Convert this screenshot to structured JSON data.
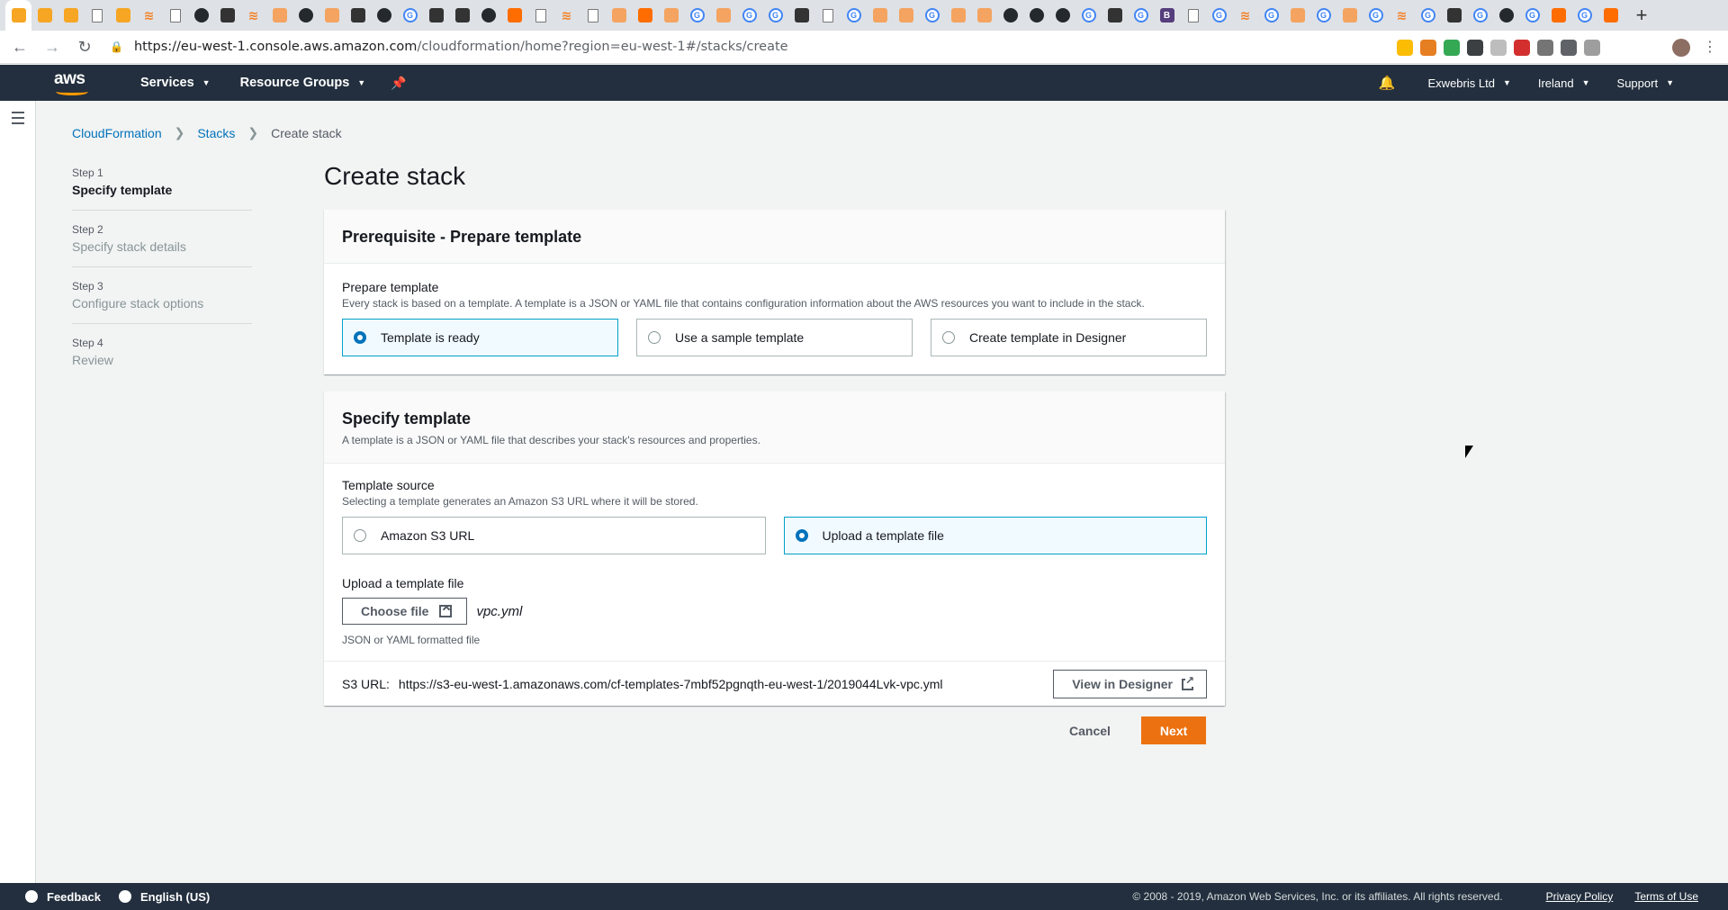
{
  "browser": {
    "url_host": "https://eu-west-1.console.aws.amazon.com",
    "url_path": "/cloudformation/home?region=eu-west-1#/stacks/create",
    "tabs": [
      {
        "icon": "aws-cube-icon",
        "kind": "aws",
        "active": true
      },
      {
        "icon": "aws-cube-icon",
        "kind": "aws"
      },
      {
        "icon": "aws-cube-icon",
        "kind": "aws"
      },
      {
        "icon": "doc-icon",
        "kind": "doc"
      },
      {
        "icon": "aws-cube-icon",
        "kind": "aws"
      },
      {
        "icon": "stackoverflow-icon",
        "kind": "so"
      },
      {
        "icon": "doc-icon",
        "kind": "doc"
      },
      {
        "icon": "github-icon",
        "kind": "gh"
      },
      {
        "icon": "pointer-icon",
        "kind": "dark"
      },
      {
        "icon": "stackoverflow-icon",
        "kind": "so"
      },
      {
        "icon": "box-icon",
        "kind": "box"
      },
      {
        "icon": "github-icon",
        "kind": "gh"
      },
      {
        "icon": "box-icon",
        "kind": "box"
      },
      {
        "icon": "table-icon",
        "kind": "dark"
      },
      {
        "icon": "github-icon",
        "kind": "gh"
      },
      {
        "icon": "google-icon",
        "kind": "g"
      },
      {
        "icon": "diamond-icon",
        "kind": "dark"
      },
      {
        "icon": "jg-icon",
        "kind": "dark"
      },
      {
        "icon": "github-icon",
        "kind": "gh"
      },
      {
        "icon": "orange-cube-icon",
        "kind": "org"
      },
      {
        "icon": "doc-icon",
        "kind": "doc"
      },
      {
        "icon": "stackoverflow-icon",
        "kind": "so"
      },
      {
        "icon": "doc-icon",
        "kind": "doc"
      },
      {
        "icon": "box-icon",
        "kind": "box"
      },
      {
        "icon": "orange-cube-icon",
        "kind": "org"
      },
      {
        "icon": "box-icon",
        "kind": "box"
      },
      {
        "icon": "google-icon",
        "kind": "g"
      },
      {
        "icon": "box-icon",
        "kind": "box"
      },
      {
        "icon": "google-icon",
        "kind": "g"
      },
      {
        "icon": "google-icon",
        "kind": "g"
      },
      {
        "icon": "php-icon",
        "kind": "dark"
      },
      {
        "icon": "doc-icon",
        "kind": "doc"
      },
      {
        "icon": "google-icon",
        "kind": "g"
      },
      {
        "icon": "box-icon",
        "kind": "box"
      },
      {
        "icon": "box-icon",
        "kind": "box"
      },
      {
        "icon": "google-icon",
        "kind": "g"
      },
      {
        "icon": "box-icon",
        "kind": "box"
      },
      {
        "icon": "box-icon",
        "kind": "box"
      },
      {
        "icon": "github-icon",
        "kind": "gh"
      },
      {
        "icon": "github-icon",
        "kind": "gh"
      },
      {
        "icon": "github-icon",
        "kind": "gh"
      },
      {
        "icon": "google-icon",
        "kind": "g"
      },
      {
        "icon": "php-icon",
        "kind": "dark"
      },
      {
        "icon": "google-icon",
        "kind": "g"
      },
      {
        "icon": "bootstrap-icon",
        "kind": "b"
      },
      {
        "icon": "doc-icon",
        "kind": "doc"
      },
      {
        "icon": "google-icon",
        "kind": "g"
      },
      {
        "icon": "stackoverflow-icon",
        "kind": "so"
      },
      {
        "icon": "google-icon",
        "kind": "g"
      },
      {
        "icon": "box-icon",
        "kind": "box"
      },
      {
        "icon": "google-icon",
        "kind": "g"
      },
      {
        "icon": "box-icon",
        "kind": "box"
      },
      {
        "icon": "google-icon",
        "kind": "g"
      },
      {
        "icon": "stackoverflow-icon",
        "kind": "so"
      },
      {
        "icon": "google-icon",
        "kind": "g"
      },
      {
        "icon": "dark-icon",
        "kind": "dark"
      },
      {
        "icon": "google-icon",
        "kind": "g"
      },
      {
        "icon": "github-icon",
        "kind": "gh"
      },
      {
        "icon": "google-icon",
        "kind": "g"
      },
      {
        "icon": "orange-cube-icon",
        "kind": "org"
      },
      {
        "icon": "google-icon",
        "kind": "g"
      },
      {
        "icon": "orange-cube-icon",
        "kind": "org"
      }
    ],
    "new_tab_glyph": "+",
    "extensions": [
      {
        "icon": "ext-badge-icon",
        "color": "#fbbc04"
      },
      {
        "icon": "ext-fire-icon",
        "color": "#e67e22"
      },
      {
        "icon": "ext-green-icon",
        "color": "#34a853"
      },
      {
        "icon": "ext-moon-icon",
        "color": "#3c4043"
      },
      {
        "icon": "ext-arrow-icon",
        "color": "#bdbdbd"
      },
      {
        "icon": "ext-abp-icon",
        "color": "#d32f2f"
      },
      {
        "icon": "ext-camera-icon",
        "color": "#757575"
      },
      {
        "icon": "ext-rss-icon",
        "color": "#5f6368"
      },
      {
        "icon": "ext-shield-icon",
        "color": "#9e9e9e"
      }
    ]
  },
  "aws_header": {
    "logo_text": "aws",
    "services": "Services",
    "resource_groups": "Resource Groups",
    "account": "Exwebris Ltd",
    "region": "Ireland",
    "support": "Support"
  },
  "breadcrumb": [
    "CloudFormation",
    "Stacks",
    "Create stack"
  ],
  "steps": [
    {
      "num": "Step 1",
      "label": "Specify template",
      "active": true
    },
    {
      "num": "Step 2",
      "label": "Specify stack details"
    },
    {
      "num": "Step 3",
      "label": "Configure stack options"
    },
    {
      "num": "Step 4",
      "label": "Review"
    }
  ],
  "page_title": "Create stack",
  "prereq": {
    "title": "Prerequisite - Prepare template",
    "field_label": "Prepare template",
    "field_desc": "Every stack is based on a template. A template is a JSON or YAML file that contains configuration information about the AWS resources you want to include in the stack.",
    "options": [
      "Template is ready",
      "Use a sample template",
      "Create template in Designer"
    ],
    "selected": 0
  },
  "specify": {
    "title": "Specify template",
    "desc": "A template is a JSON or YAML file that describes your stack's resources and properties.",
    "source_label": "Template source",
    "source_desc": "Selecting a template generates an Amazon S3 URL where it will be stored.",
    "source_options": [
      "Amazon S3 URL",
      "Upload a template file"
    ],
    "selected": 1,
    "upload_label": "Upload a template file",
    "choose_file": "Choose file",
    "file_name": "vpc.yml",
    "file_hint": "JSON or YAML formatted file",
    "s3_label": "S3 URL:",
    "s3_url": "https://s3-eu-west-1.amazonaws.com/cf-templates-7mbf52pgnqth-eu-west-1/2019044Lvk-vpc.yml",
    "view_designer": "View in Designer"
  },
  "actions": {
    "cancel": "Cancel",
    "next": "Next"
  },
  "footer": {
    "feedback": "Feedback",
    "language": "English (US)",
    "copyright": "© 2008 - 2019, Amazon Web Services, Inc. or its affiliates. All rights reserved.",
    "privacy": "Privacy Policy",
    "terms": "Terms of Use"
  },
  "colors": {
    "accent": "#0073bb",
    "primary_button": "#ec7211",
    "nav_bg": "#232f3e",
    "selected_tile_border": "#00a1c9"
  }
}
